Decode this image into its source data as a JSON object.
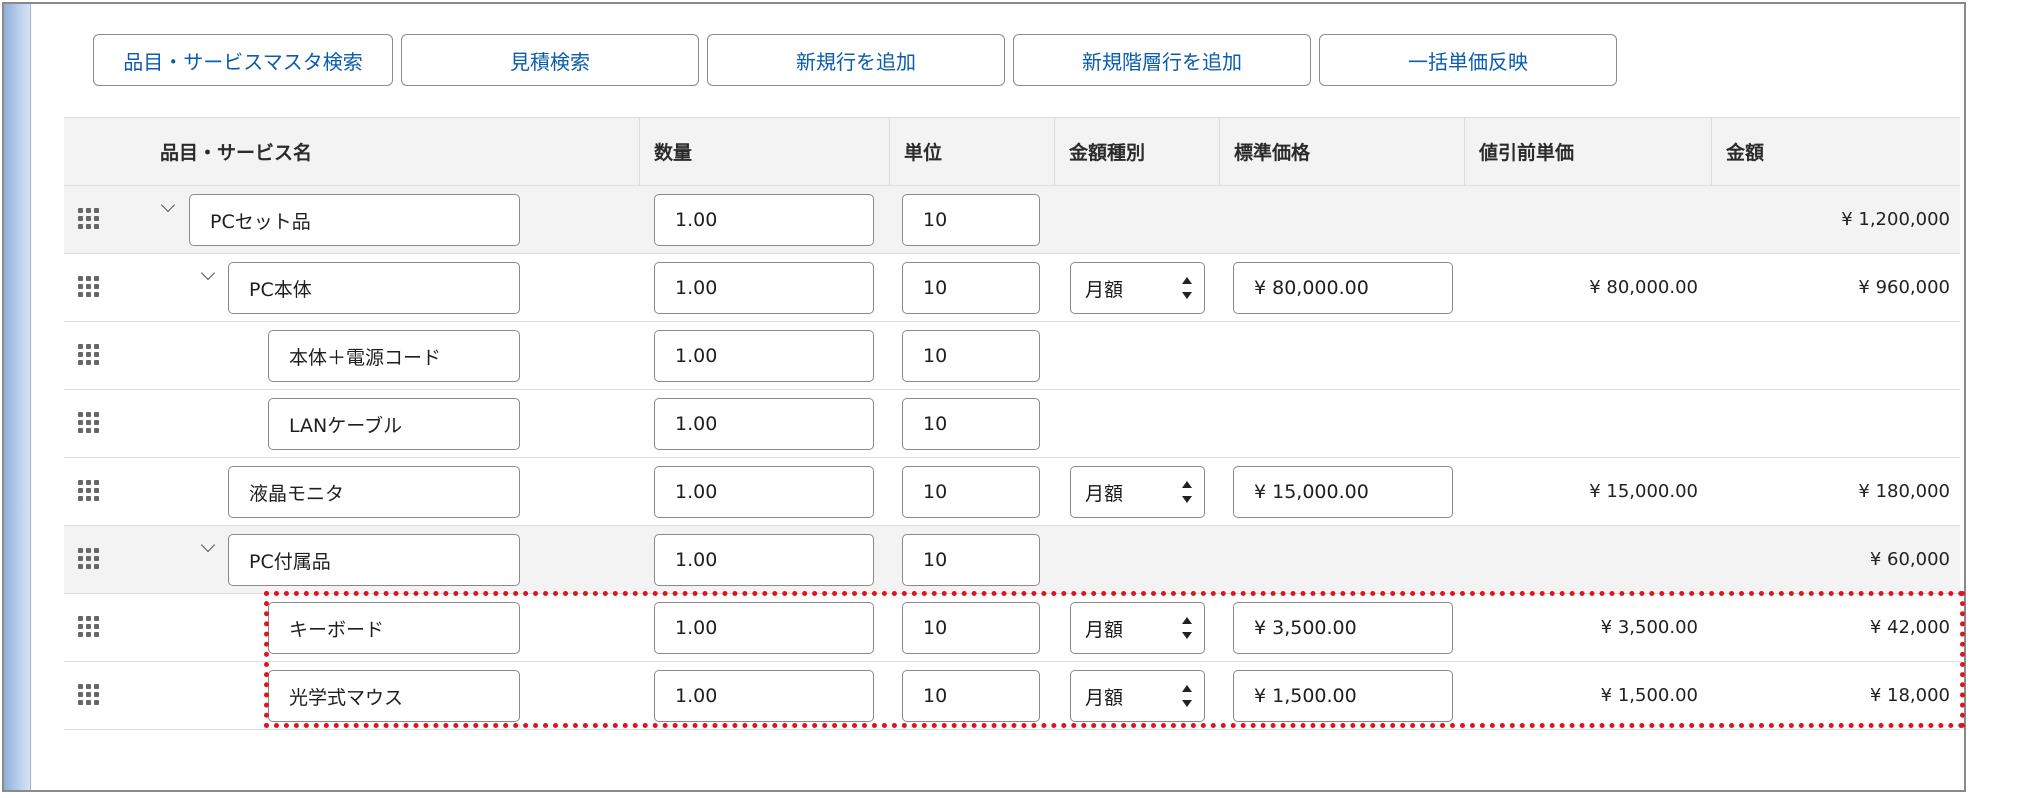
{
  "toolbar": {
    "buttons": [
      "品目・サービスマスタ検索",
      "見積検索",
      "新規行を追加",
      "新規階層行を追加",
      "一括単価反映"
    ]
  },
  "columns": [
    "品目・サービス名",
    "数量",
    "単位",
    "金額種別",
    "標準価格",
    "値引前単価",
    "金額"
  ],
  "rows": [
    {
      "name": "PCセット品",
      "qty": "1.00",
      "unit": "10",
      "kind": "",
      "std_price": "",
      "pre_price": "",
      "amount": "¥ 1,200,000"
    },
    {
      "name": "PC本体",
      "qty": "1.00",
      "unit": "10",
      "kind": "月額",
      "std_price": "¥ 80,000.00",
      "pre_price": "¥ 80,000.00",
      "amount": "¥ 960,000"
    },
    {
      "name": "本体＋電源コード",
      "qty": "1.00",
      "unit": "10",
      "kind": "",
      "std_price": "",
      "pre_price": "",
      "amount": ""
    },
    {
      "name": "LANケーブル",
      "qty": "1.00",
      "unit": "10",
      "kind": "",
      "std_price": "",
      "pre_price": "",
      "amount": ""
    },
    {
      "name": "液晶モニタ",
      "qty": "1.00",
      "unit": "10",
      "kind": "月額",
      "std_price": "¥ 15,000.00",
      "pre_price": "¥ 15,000.00",
      "amount": "¥ 180,000"
    },
    {
      "name": "PC付属品",
      "qty": "1.00",
      "unit": "10",
      "kind": "",
      "std_price": "",
      "pre_price": "",
      "amount": "¥ 60,000"
    },
    {
      "name": "キーボード",
      "qty": "1.00",
      "unit": "10",
      "kind": "月額",
      "std_price": "¥ 3,500.00",
      "pre_price": "¥ 3,500.00",
      "amount": "¥ 42,000"
    },
    {
      "name": "光学式マウス",
      "qty": "1.00",
      "unit": "10",
      "kind": "月額",
      "std_price": "¥ 1,500.00",
      "pre_price": "¥ 1,500.00",
      "amount": "¥ 18,000"
    }
  ],
  "colors": {
    "link_blue": "#0b5cad",
    "highlight_red": "#e0141c",
    "header_bg": "#f3f3f3"
  },
  "icons": {
    "drag_handle": "drag-handle-icon",
    "expand": "chevron-down-icon",
    "select_arrows": "up-down-arrows-icon"
  }
}
